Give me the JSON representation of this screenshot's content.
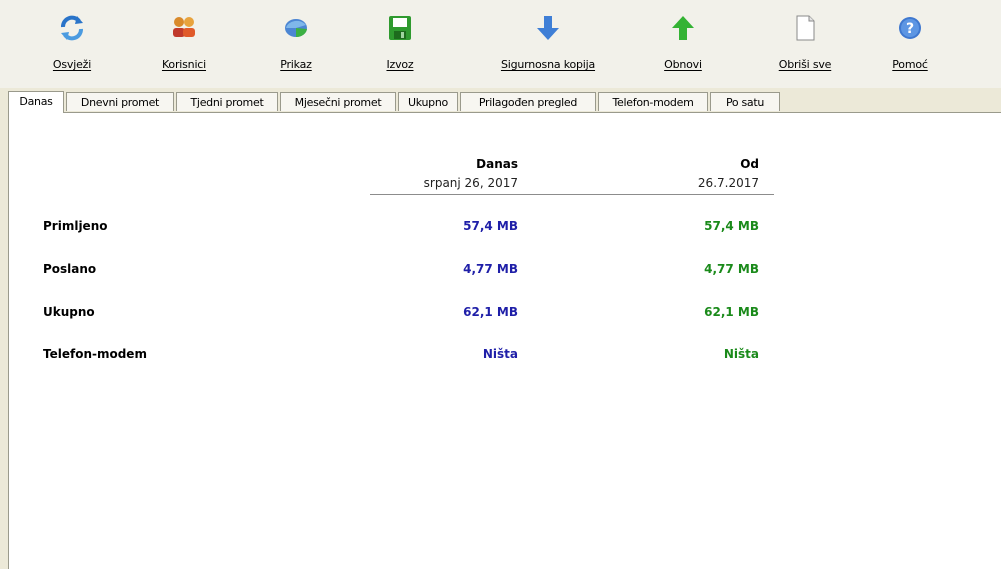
{
  "toolbar": {
    "buttons": [
      {
        "label": "Osvježi",
        "icon": "refresh-icon"
      },
      {
        "label": "Korisnici",
        "icon": "users-icon"
      },
      {
        "label": "Prikaz",
        "icon": "view-icon"
      },
      {
        "label": "Izvoz",
        "icon": "save-icon"
      },
      {
        "label": "Sigurnosna kopija",
        "icon": "arrow-down-icon"
      },
      {
        "label": "Obnovi",
        "icon": "arrow-up-icon"
      },
      {
        "label": "Obriši sve",
        "icon": "document-icon"
      },
      {
        "label": "Pomoć",
        "icon": "help-icon"
      }
    ]
  },
  "tabs": [
    {
      "label": "Danas",
      "active": true
    },
    {
      "label": "Dnevni promet"
    },
    {
      "label": "Tjedni promet"
    },
    {
      "label": "Mjesečni promet"
    },
    {
      "label": "Ukupno"
    },
    {
      "label": "Prilagođen pregled"
    },
    {
      "label": "Telefon-modem"
    },
    {
      "label": "Po satu"
    }
  ],
  "table": {
    "columns": [
      {
        "title": "Danas",
        "subtitle": "srpanj 26, 2017"
      },
      {
        "title": "Od",
        "subtitle": "26.7.2017"
      }
    ],
    "rows": [
      {
        "label": "Primljeno",
        "values": [
          "57,4 MB",
          "57,4 MB"
        ]
      },
      {
        "label": "Poslano",
        "values": [
          "4,77 MB",
          "4,77 MB"
        ]
      },
      {
        "label": "Ukupno",
        "values": [
          "62,1 MB",
          "62,1 MB"
        ]
      },
      {
        "label": "Telefon-modem",
        "values": [
          "Ništa",
          "Ništa"
        ]
      }
    ]
  },
  "colors": {
    "today_value": "#1f1fa8",
    "since_value": "#1a8a1a"
  }
}
